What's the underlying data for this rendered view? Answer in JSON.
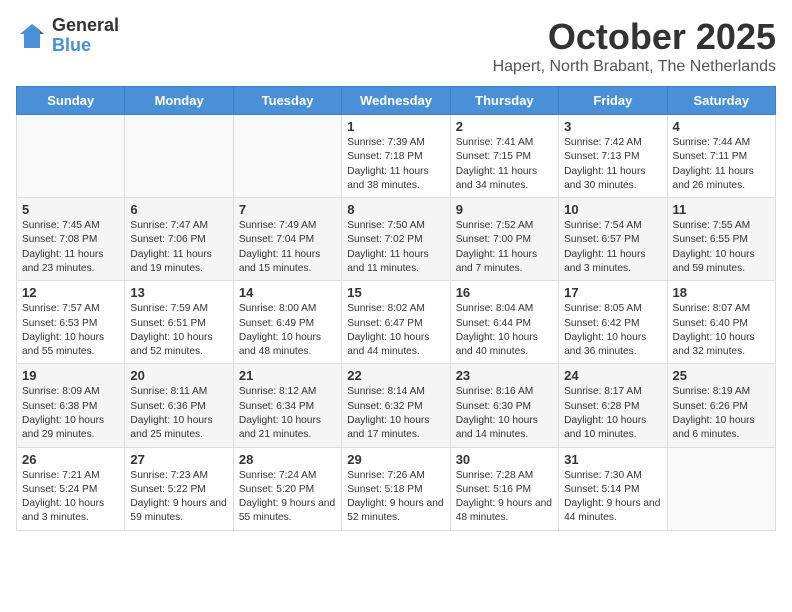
{
  "logo": {
    "general": "General",
    "blue": "Blue"
  },
  "title": "October 2025",
  "subtitle": "Hapert, North Brabant, The Netherlands",
  "days_of_week": [
    "Sunday",
    "Monday",
    "Tuesday",
    "Wednesday",
    "Thursday",
    "Friday",
    "Saturday"
  ],
  "weeks": [
    [
      {
        "day": "",
        "info": ""
      },
      {
        "day": "",
        "info": ""
      },
      {
        "day": "",
        "info": ""
      },
      {
        "day": "1",
        "info": "Sunrise: 7:39 AM\nSunset: 7:18 PM\nDaylight: 11 hours and 38 minutes."
      },
      {
        "day": "2",
        "info": "Sunrise: 7:41 AM\nSunset: 7:15 PM\nDaylight: 11 hours and 34 minutes."
      },
      {
        "day": "3",
        "info": "Sunrise: 7:42 AM\nSunset: 7:13 PM\nDaylight: 11 hours and 30 minutes."
      },
      {
        "day": "4",
        "info": "Sunrise: 7:44 AM\nSunset: 7:11 PM\nDaylight: 11 hours and 26 minutes."
      }
    ],
    [
      {
        "day": "5",
        "info": "Sunrise: 7:45 AM\nSunset: 7:08 PM\nDaylight: 11 hours and 23 minutes."
      },
      {
        "day": "6",
        "info": "Sunrise: 7:47 AM\nSunset: 7:06 PM\nDaylight: 11 hours and 19 minutes."
      },
      {
        "day": "7",
        "info": "Sunrise: 7:49 AM\nSunset: 7:04 PM\nDaylight: 11 hours and 15 minutes."
      },
      {
        "day": "8",
        "info": "Sunrise: 7:50 AM\nSunset: 7:02 PM\nDaylight: 11 hours and 11 minutes."
      },
      {
        "day": "9",
        "info": "Sunrise: 7:52 AM\nSunset: 7:00 PM\nDaylight: 11 hours and 7 minutes."
      },
      {
        "day": "10",
        "info": "Sunrise: 7:54 AM\nSunset: 6:57 PM\nDaylight: 11 hours and 3 minutes."
      },
      {
        "day": "11",
        "info": "Sunrise: 7:55 AM\nSunset: 6:55 PM\nDaylight: 10 hours and 59 minutes."
      }
    ],
    [
      {
        "day": "12",
        "info": "Sunrise: 7:57 AM\nSunset: 6:53 PM\nDaylight: 10 hours and 55 minutes."
      },
      {
        "day": "13",
        "info": "Sunrise: 7:59 AM\nSunset: 6:51 PM\nDaylight: 10 hours and 52 minutes."
      },
      {
        "day": "14",
        "info": "Sunrise: 8:00 AM\nSunset: 6:49 PM\nDaylight: 10 hours and 48 minutes."
      },
      {
        "day": "15",
        "info": "Sunrise: 8:02 AM\nSunset: 6:47 PM\nDaylight: 10 hours and 44 minutes."
      },
      {
        "day": "16",
        "info": "Sunrise: 8:04 AM\nSunset: 6:44 PM\nDaylight: 10 hours and 40 minutes."
      },
      {
        "day": "17",
        "info": "Sunrise: 8:05 AM\nSunset: 6:42 PM\nDaylight: 10 hours and 36 minutes."
      },
      {
        "day": "18",
        "info": "Sunrise: 8:07 AM\nSunset: 6:40 PM\nDaylight: 10 hours and 32 minutes."
      }
    ],
    [
      {
        "day": "19",
        "info": "Sunrise: 8:09 AM\nSunset: 6:38 PM\nDaylight: 10 hours and 29 minutes."
      },
      {
        "day": "20",
        "info": "Sunrise: 8:11 AM\nSunset: 6:36 PM\nDaylight: 10 hours and 25 minutes."
      },
      {
        "day": "21",
        "info": "Sunrise: 8:12 AM\nSunset: 6:34 PM\nDaylight: 10 hours and 21 minutes."
      },
      {
        "day": "22",
        "info": "Sunrise: 8:14 AM\nSunset: 6:32 PM\nDaylight: 10 hours and 17 minutes."
      },
      {
        "day": "23",
        "info": "Sunrise: 8:16 AM\nSunset: 6:30 PM\nDaylight: 10 hours and 14 minutes."
      },
      {
        "day": "24",
        "info": "Sunrise: 8:17 AM\nSunset: 6:28 PM\nDaylight: 10 hours and 10 minutes."
      },
      {
        "day": "25",
        "info": "Sunrise: 8:19 AM\nSunset: 6:26 PM\nDaylight: 10 hours and 6 minutes."
      }
    ],
    [
      {
        "day": "26",
        "info": "Sunrise: 7:21 AM\nSunset: 5:24 PM\nDaylight: 10 hours and 3 minutes."
      },
      {
        "day": "27",
        "info": "Sunrise: 7:23 AM\nSunset: 5:22 PM\nDaylight: 9 hours and 59 minutes."
      },
      {
        "day": "28",
        "info": "Sunrise: 7:24 AM\nSunset: 5:20 PM\nDaylight: 9 hours and 55 minutes."
      },
      {
        "day": "29",
        "info": "Sunrise: 7:26 AM\nSunset: 5:18 PM\nDaylight: 9 hours and 52 minutes."
      },
      {
        "day": "30",
        "info": "Sunrise: 7:28 AM\nSunset: 5:16 PM\nDaylight: 9 hours and 48 minutes."
      },
      {
        "day": "31",
        "info": "Sunrise: 7:30 AM\nSunset: 5:14 PM\nDaylight: 9 hours and 44 minutes."
      },
      {
        "day": "",
        "info": ""
      }
    ]
  ]
}
